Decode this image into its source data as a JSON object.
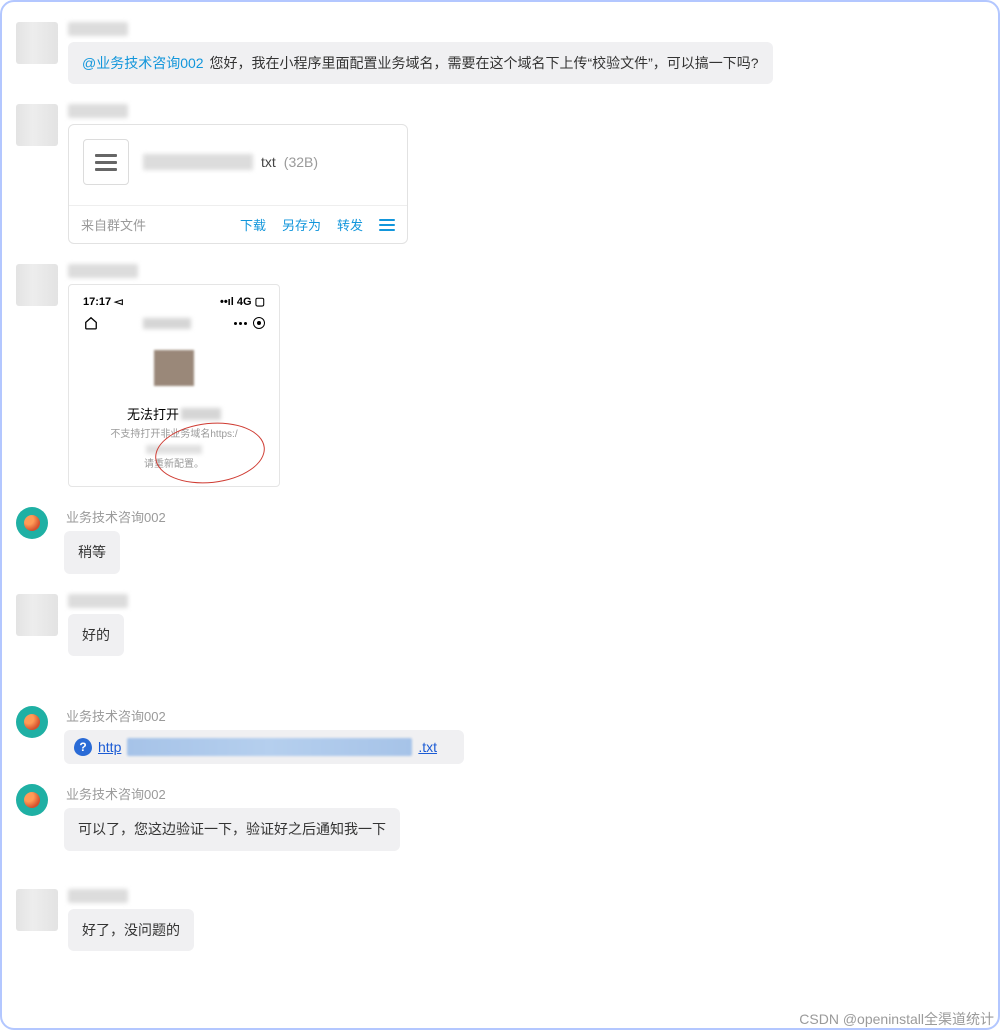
{
  "messages": {
    "m1": {
      "mention": "@业务技术咨询002",
      "text": " 您好，我在小程序里面配置业务域名，需要在这个域名下上传“校验文件”，可以搞一下吗?"
    },
    "m2_file": {
      "ext": "txt",
      "size": "(32B)",
      "source": "来自群文件",
      "actions": {
        "download": "下载",
        "saveas": "另存为",
        "forward": "转发"
      }
    },
    "m3_screenshot": {
      "time": "17:17",
      "signal": "4G",
      "cannot_open": "无法打开",
      "sub_prefix": "不支持打开非业务域名https:/",
      "sub_suffix": "请重新配置。"
    },
    "m4": {
      "sender": "业务技术咨询002",
      "text": "稍等"
    },
    "m5": {
      "text": "好的"
    },
    "m6": {
      "sender": "业务技术咨询002",
      "link_prefix": "http",
      "link_suffix": ".txt"
    },
    "m7": {
      "sender": "业务技术咨询002",
      "text": "可以了，您这边验证一下，验证好之后通知我一下"
    },
    "m8": {
      "text": "好了，没问题的"
    }
  },
  "watermark": "CSDN @openinstall全渠道统计"
}
